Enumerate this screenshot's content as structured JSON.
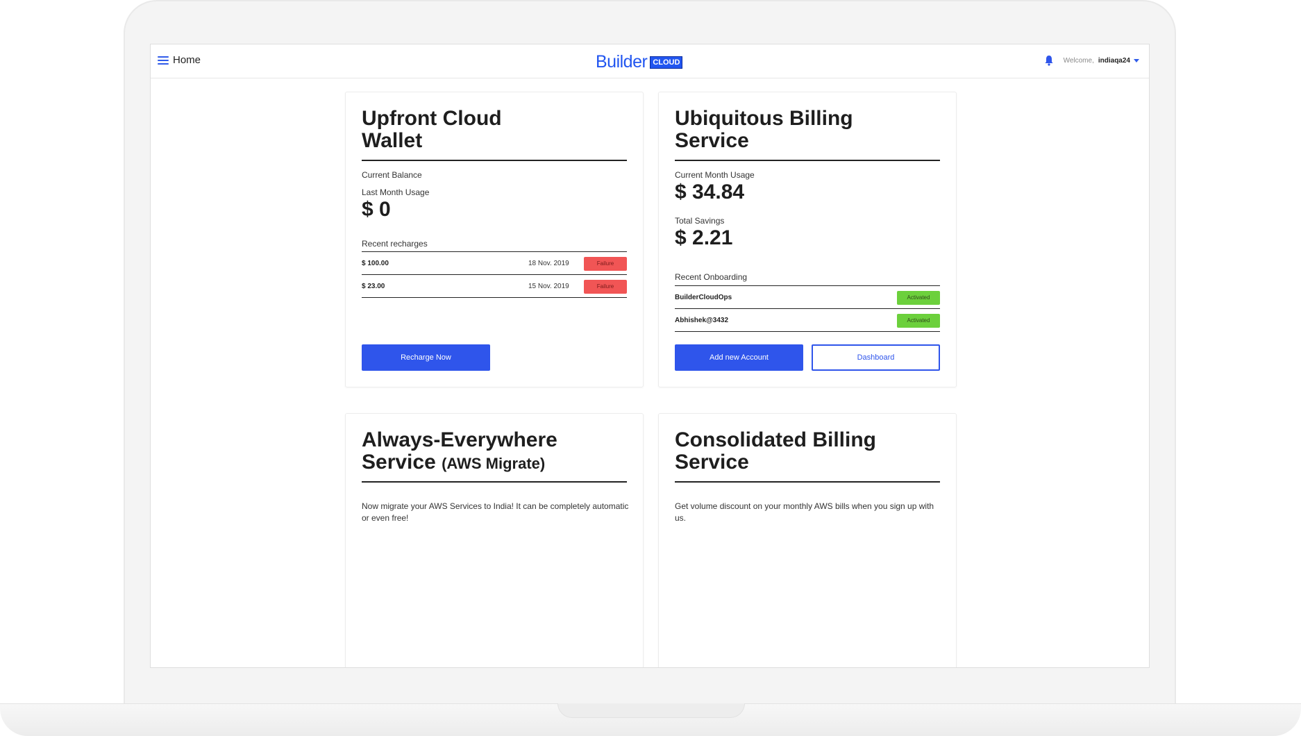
{
  "topbar": {
    "home_label": "Home",
    "logo_text": "Builder",
    "logo_badge": "CLOUD",
    "welcome": "Welcome,",
    "username": "indiaqa24"
  },
  "colors": {
    "accent": "#2f55eb",
    "failure": "#f15555",
    "activated": "#6cd03c"
  },
  "wallet": {
    "title_line1": "Upfront Cloud",
    "title_line2": "Wallet",
    "current_balance_label": "Current Balance",
    "last_month_label": "Last Month Usage",
    "last_month_amount": "$ 0",
    "recent_label": "Recent recharges",
    "recharges": [
      {
        "amount": "$ 100.00",
        "date": "18 Nov. 2019",
        "status": "Failure"
      },
      {
        "amount": "$ 23.00",
        "date": "15 Nov. 2019",
        "status": "Failure"
      }
    ],
    "recharge_button": "Recharge Now"
  },
  "billing": {
    "title_line1": "Ubiquitous Billing",
    "title_line2": "Service",
    "current_usage_label": "Current Month Usage",
    "current_usage_amount": "$ 34.84",
    "savings_label": "Total Savings",
    "savings_amount": "$ 2.21",
    "recent_label": "Recent Onboarding",
    "onboarding": [
      {
        "name": "BuilderCloudOps",
        "status": "Activated"
      },
      {
        "name": "Abhishek@3432",
        "status": "Activated"
      }
    ],
    "add_account_button": "Add new Account",
    "dashboard_button": "Dashboard"
  },
  "migrate": {
    "title_line1": "Always-Everywhere",
    "title_line2": "Service",
    "title_sub": "(AWS Migrate)",
    "description": "Now migrate your AWS Services to India! It can be completely automatic or even free!"
  },
  "consolidated": {
    "title_line1": "Consolidated Billing",
    "title_line2": "Service",
    "description": "Get volume discount on your monthly AWS bills when you sign up with us."
  }
}
